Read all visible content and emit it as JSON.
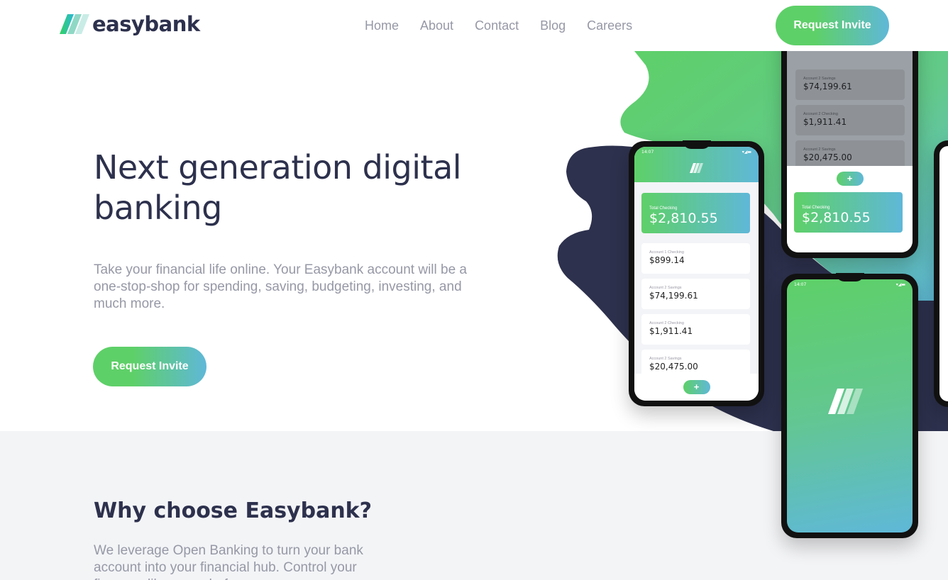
{
  "header": {
    "logo_text": "easybank",
    "nav": [
      "Home",
      "About",
      "Contact",
      "Blog",
      "Careers"
    ],
    "cta_label": "Request Invite"
  },
  "hero": {
    "title": "Next generation digital banking",
    "description": "Take your financial life online. Your Easybank account will be a one-stop-shop for spending, saving, budgeting, investing, and much more.",
    "cta_label": "Request Invite"
  },
  "mockup": {
    "status_time": "14:07",
    "total_label": "Total Checking",
    "total_value": "$2,810.55",
    "accounts": [
      {
        "label": "Account 1 Checking",
        "value": "$899.14"
      },
      {
        "label": "Account 2 Savings",
        "value": "$74,199.61"
      },
      {
        "label": "Account 2 Checking",
        "value": "$1,911.41"
      },
      {
        "label": "Account 2 Savings",
        "value": "$20,475.00"
      }
    ]
  },
  "why": {
    "title": "Why choose Easybank?",
    "description": "We leverage Open Banking to turn your bank account into your financial hub. Control your finances like never before."
  },
  "colors": {
    "dark_blue": "#2d314d",
    "lime_green": "#31d35c",
    "bright_cyan": "#2bb7da",
    "grayish_blue": "#9698a6",
    "light_gray": "#f3f4f6"
  }
}
